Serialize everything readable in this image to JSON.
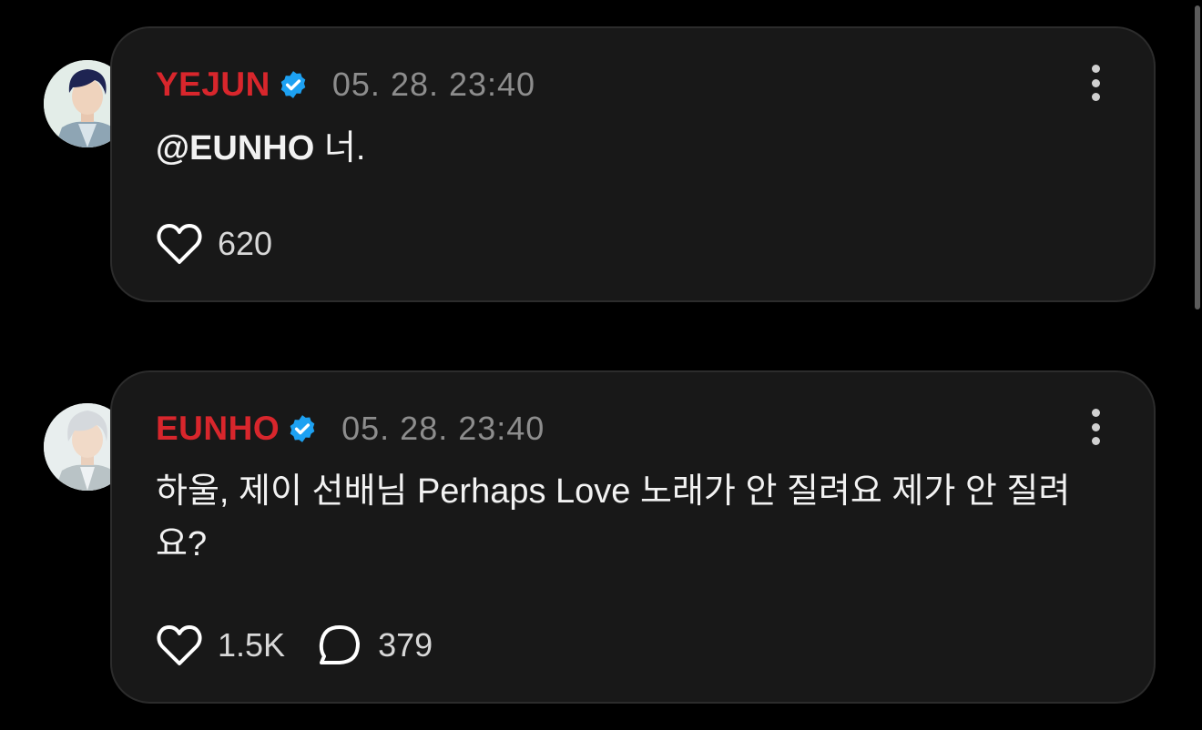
{
  "posts": [
    {
      "author": "YEJUN",
      "timestamp": "05. 28. 23:40",
      "mention": "@EUNHO",
      "text": " 너.",
      "likes": "620"
    },
    {
      "author": "EUNHO",
      "timestamp": "05. 28. 23:40",
      "text": "하울, 제이 선배님 Perhaps Love 노래가 안 질려요 제가 안 질려요?",
      "likes": "1.5K",
      "replies": "379"
    }
  ],
  "colors": {
    "background": "#000000",
    "card": "#181818",
    "author_name": "#d8262c",
    "verified_badge": "#1da1f2",
    "timestamp": "#8d8d8d"
  },
  "icons": [
    "verified-badge-icon",
    "more-options-icon",
    "heart-icon",
    "comment-icon"
  ]
}
